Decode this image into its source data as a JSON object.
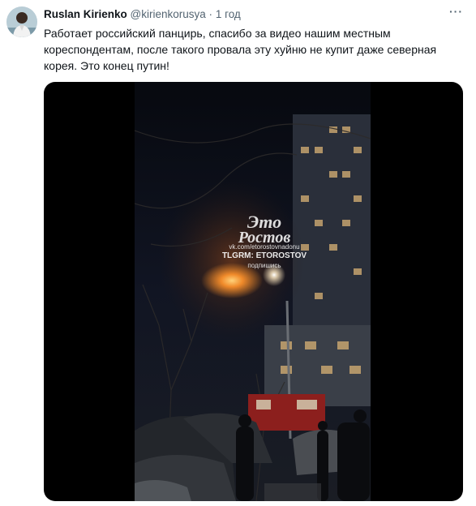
{
  "tweet": {
    "author_name": "Ruslan Kirienko",
    "author_handle": "@kirienkorusya",
    "separator": "·",
    "timestamp": "1 год",
    "more_label": "···",
    "text": "Работает российский панцирь, спасибо за видео нашим местным кореспондентам, после такого провала эту хуйню не купит даже северная корея. Это конец путин!"
  },
  "media": {
    "watermark_logo_line1": "Это",
    "watermark_logo_line2": "Ростов",
    "watermark_url": "vk.com/etorostovnadonu",
    "watermark_tg": "TLGRM: ETOROSTOV",
    "watermark_subscribe": "подпишись"
  }
}
